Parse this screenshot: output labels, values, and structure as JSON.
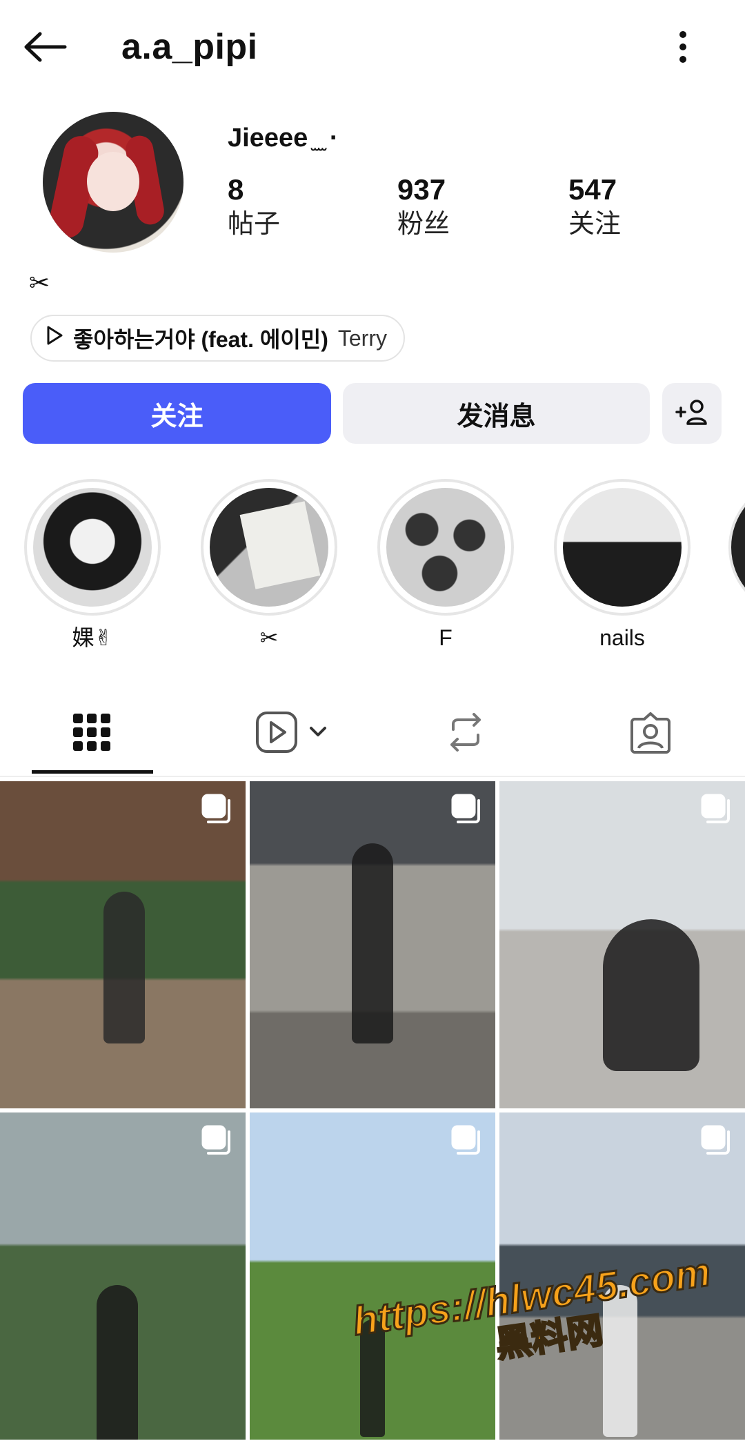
{
  "header": {
    "username": "a.a_pipi"
  },
  "profile": {
    "display_name": "Jieeee ̫ ̫ ·",
    "stats": [
      {
        "value": "8",
        "label": "帖子"
      },
      {
        "value": "937",
        "label": "粉丝"
      },
      {
        "value": "547",
        "label": "关注"
      }
    ],
    "bio": "✂",
    "music": {
      "title": "좋아하는거야 (feat. 에이민)",
      "artist": "Terry"
    }
  },
  "actions": {
    "follow_label": "关注",
    "message_label": "发消息"
  },
  "highlights": [
    {
      "label": "婐✌"
    },
    {
      "label": "✂"
    },
    {
      "label": "F"
    },
    {
      "label": "nails"
    }
  ],
  "tabs": [
    "grid-icon",
    "reels-icon",
    "reposts-icon",
    "tagged-icon"
  ],
  "watermark": {
    "url": "https://hlwc45.com",
    "text": "黑料网"
  },
  "colors": {
    "accent": "#4a5df9",
    "button_bg": "#efeff3"
  }
}
